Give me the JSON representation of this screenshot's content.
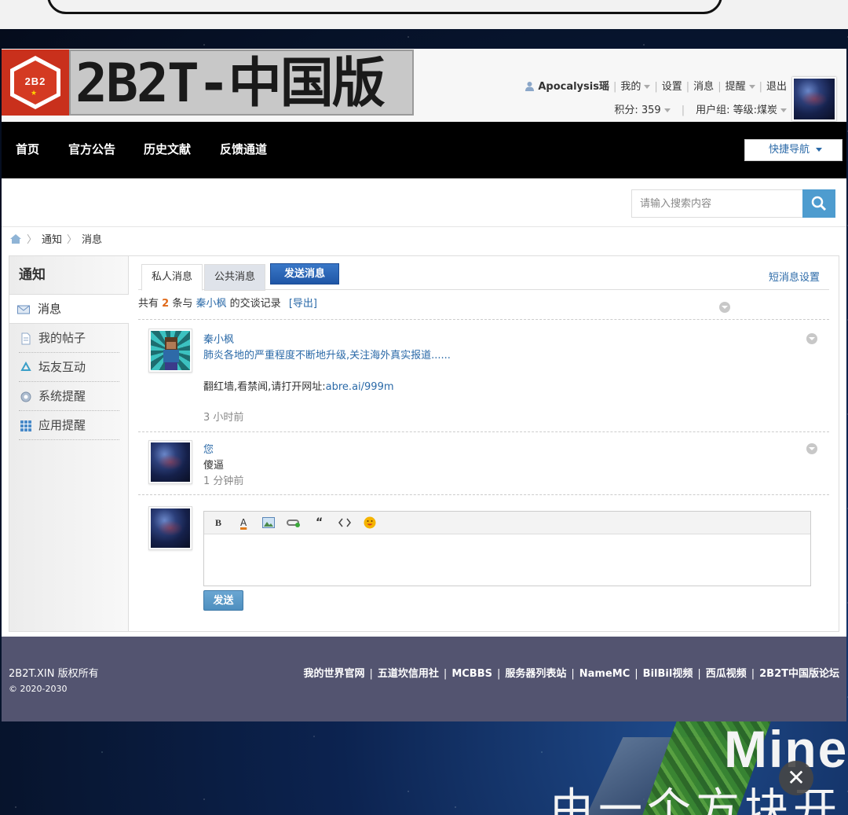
{
  "site": {
    "logo_text": "2B2T-中国版",
    "logo_badge": "2B2"
  },
  "user_bar": {
    "username": "Apocalysis瑶",
    "mine": "我的",
    "settings": "设置",
    "messages": "消息",
    "reminders": "提醒",
    "logout": "退出",
    "points": "积分: 359",
    "user_group": "用户组: 等级:煤炭"
  },
  "nav": {
    "items": [
      "首页",
      "官方公告",
      "历史文献",
      "反馈通道"
    ],
    "quick_nav": "快捷导航"
  },
  "search": {
    "placeholder": "请输入搜索内容",
    "icon": "search-icon"
  },
  "breadcrumb": [
    "通知",
    "消息"
  ],
  "sidebar": {
    "title": "通知",
    "items": [
      {
        "label": "消息",
        "icon": "mail-icon"
      },
      {
        "label": "我的帖子",
        "icon": "document-icon"
      },
      {
        "label": "坛友互动",
        "icon": "recycle-icon"
      },
      {
        "label": "系统提醒",
        "icon": "gear-icon"
      },
      {
        "label": "应用提醒",
        "icon": "grid-icon"
      }
    ]
  },
  "tabs": {
    "private": "私人消息",
    "public": "公共消息",
    "send": "发送消息",
    "settings": "短消息设置"
  },
  "summary": {
    "prefix": "共有",
    "count": "2",
    "middle": "条与",
    "contact": "秦小枫",
    "suffix": "的交谈记录",
    "export": "[导出]"
  },
  "messages": [
    {
      "author": "秦小枫",
      "line1": "肺炎各地的严重程度不断地升级,关注海外真实报道......",
      "line2_text": "翻红墙,看禁闻,请打开网址:",
      "line2_link": "abre.ai/999m",
      "time": "3 小时前"
    },
    {
      "author": "您",
      "text": "傻逼",
      "time": "1 分钟前"
    }
  ],
  "editor": {
    "tools": [
      "B",
      "A",
      "image-icon",
      "link-icon",
      "“",
      "code-icon",
      "smiley-icon"
    ],
    "send": "发送"
  },
  "footer": {
    "copyright": "2B2T.XIN 版权所有",
    "years": "© 2020-2030",
    "links": [
      "我的世界官网",
      "五道坎信用社",
      "MCBBS",
      "服务器列表站",
      "NameMC",
      "BilBil视频",
      "西瓜视频",
      "2B2T中国版论坛"
    ]
  },
  "background": {
    "title": "Mine",
    "subtitle": "由一个方块开"
  },
  "colors": {
    "link": "#2b6aa8",
    "nav_bg": "#000000",
    "footer_bg": "#535470",
    "accent_orange": "#e06a1a",
    "search_btn": "#4e9ccf"
  }
}
